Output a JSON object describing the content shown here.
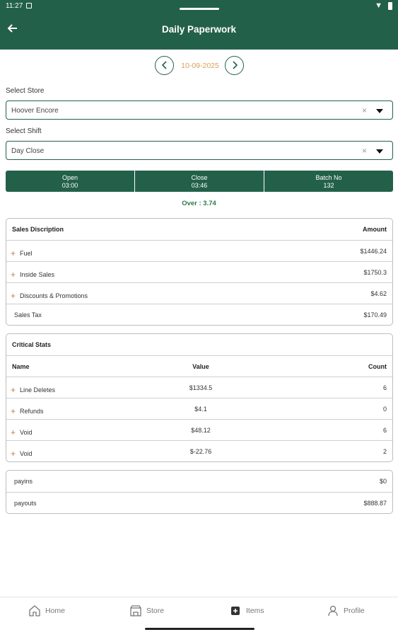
{
  "status": {
    "time": "11:27"
  },
  "header": {
    "title": "Daily Paperwork"
  },
  "date_nav": {
    "date": "10-09-2025"
  },
  "store": {
    "label": "Select Store",
    "value": "Hoover Encore",
    "clear": "×"
  },
  "shift": {
    "label": "Select Shift",
    "value": "Day Close",
    "clear": "×"
  },
  "shift_info": [
    {
      "title": "Open",
      "value": "03:00"
    },
    {
      "title": "Close",
      "value": "03:46"
    },
    {
      "title": "Batch No",
      "value": "132"
    }
  ],
  "over": "Over : 3.74",
  "sales": {
    "header_left": "Sales Discription",
    "header_right": "Amount",
    "rows": [
      {
        "label": "Fuel",
        "amount": "$1446.24"
      },
      {
        "label": "Inside Sales",
        "amount": "$1750.3"
      },
      {
        "label": "Discounts & Promotions",
        "amount": "$4.62"
      },
      {
        "label": "Sales Tax",
        "amount": "$170.49"
      }
    ]
  },
  "critical": {
    "title": "Critical Stats",
    "col_name": "Name",
    "col_value": "Value",
    "col_count": "Count",
    "rows": [
      {
        "name": "Line Deletes",
        "value": "$1334.5",
        "count": "6"
      },
      {
        "name": "Refunds",
        "value": "$4.1",
        "count": "0"
      },
      {
        "name": "Void",
        "value": "$48.12",
        "count": "6"
      },
      {
        "name": "Void",
        "value": "$-22.76",
        "count": "2"
      }
    ]
  },
  "pay": {
    "rows": [
      {
        "label": "payins",
        "amount": "$0"
      },
      {
        "label": "payouts",
        "amount": "$888.87"
      }
    ]
  },
  "nav": {
    "home": "Home",
    "store": "Store",
    "items": "Items",
    "profile": "Profile"
  },
  "colors": {
    "primary": "#23604a",
    "date": "#d9a15a",
    "over": "#2c7a43",
    "plus": "#c47b4d"
  }
}
